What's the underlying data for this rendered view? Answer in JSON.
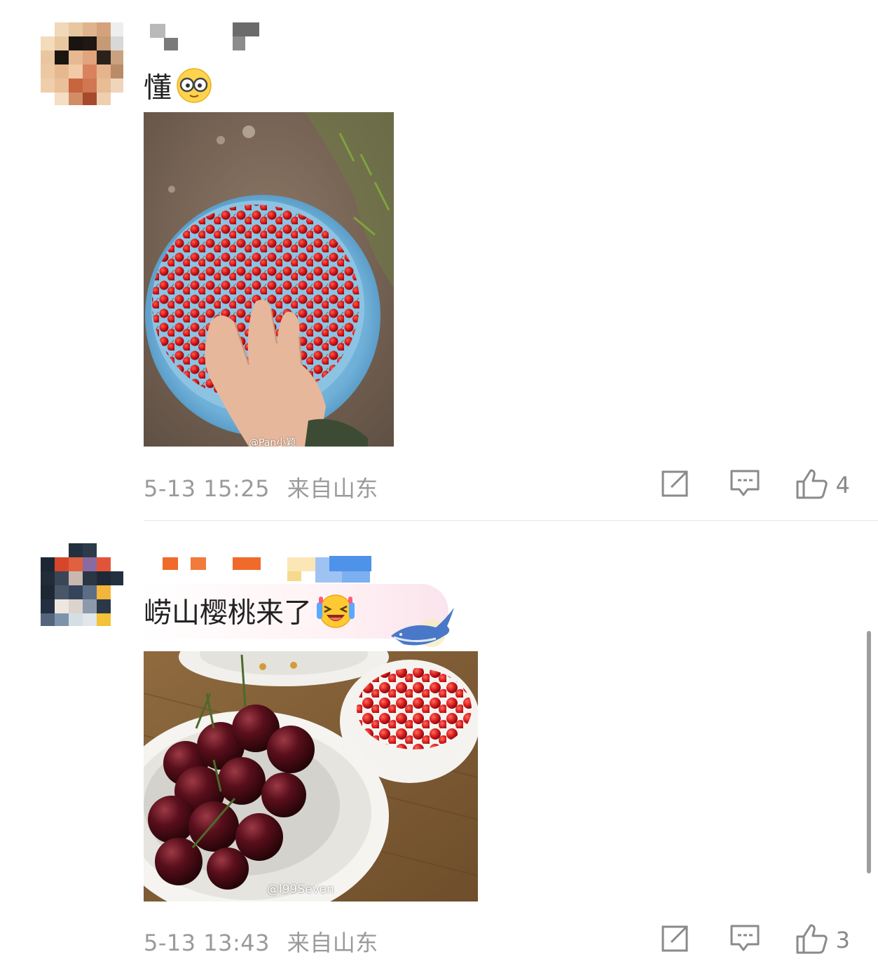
{
  "comments": [
    {
      "text": "懂",
      "emoji": "nerd-glasses-emoji",
      "photo": {
        "watermark": "@Pan小颖",
        "subject": "cherries-in-blue-basin"
      },
      "time": "5-13 15:25",
      "location": "来自山东",
      "likes": "4"
    },
    {
      "text": "崂山樱桃来了",
      "emoji": "laughing-tears-emoji",
      "photo": {
        "watermark": "@l99Seven",
        "subject": "dark-and-red-cherries-in-bowls"
      },
      "time": "5-13 13:43",
      "location": "来自山东",
      "likes": "3"
    }
  ],
  "icons": {
    "repost": "repost-icon",
    "comment": "comment-icon",
    "like": "thumbs-up-icon"
  },
  "colors": {
    "meta": "#9a9a9a",
    "icon": "#8a8a8a",
    "text": "#222222"
  }
}
